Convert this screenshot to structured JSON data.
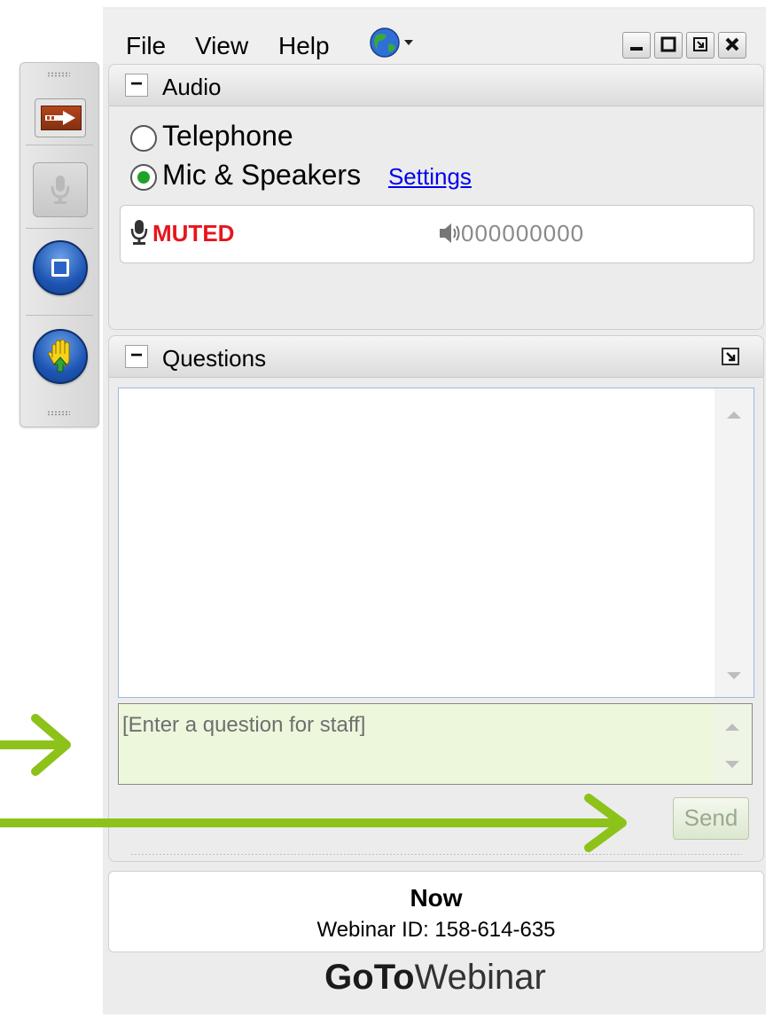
{
  "menu": {
    "file": "File",
    "view": "View",
    "help": "Help"
  },
  "window_controls": [
    "minimize",
    "maximize",
    "restore",
    "close"
  ],
  "audio": {
    "title": "Audio",
    "options": [
      {
        "label": "Telephone",
        "selected": false
      },
      {
        "label": "Mic & Speakers",
        "selected": true
      }
    ],
    "settings_link": "Settings",
    "mute_status": "MUTED",
    "speaker_level": "000000000"
  },
  "questions": {
    "title": "Questions",
    "input_placeholder": "[Enter a question for staff]",
    "send_label": "Send"
  },
  "footer": {
    "status": "Now",
    "webinar_id": "Webinar ID: 158-614-635"
  },
  "brand": {
    "part1": "GoTo",
    "part2": "Webinar"
  },
  "colors": {
    "muted_red": "#e8141b",
    "link_blue": "#0000ee",
    "input_green": "#ecf7dc",
    "annotation_arrow": "#8cc21a",
    "radio_green": "#1fa12a"
  },
  "icons": [
    "globe-icon",
    "microphone-icon",
    "speaker-icon",
    "arrow-icon",
    "screen-icon",
    "raise-hand-icon",
    "popout-icon"
  ]
}
